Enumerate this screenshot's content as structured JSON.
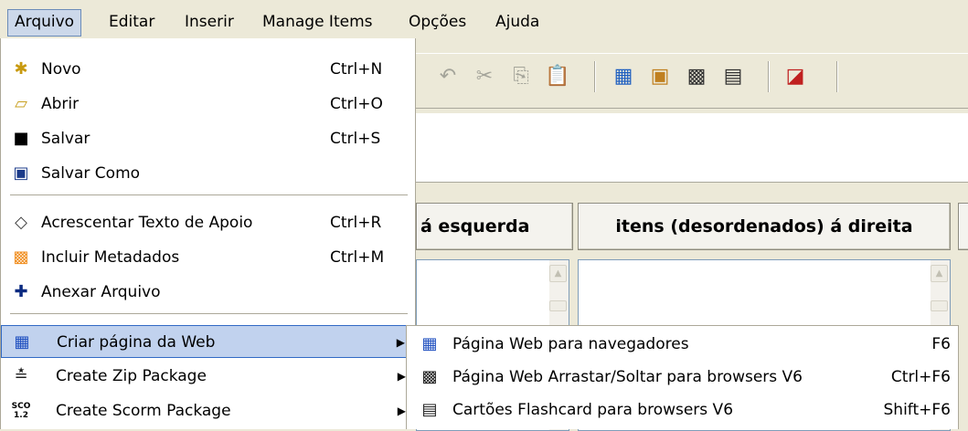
{
  "menubar": {
    "items": [
      "Arquivo",
      "Editar",
      "Inserir",
      "Manage Items",
      "Opções",
      "Ajuda"
    ]
  },
  "file_menu": {
    "items": [
      {
        "label": "Novo",
        "shortcut": "Ctrl+N",
        "icon": "new-file-icon"
      },
      {
        "label": "Abrir",
        "shortcut": "Ctrl+O",
        "icon": "open-folder-icon"
      },
      {
        "label": "Salvar",
        "shortcut": "Ctrl+S",
        "icon": "save-disk-icon"
      },
      {
        "label": "Salvar Como",
        "shortcut": "",
        "icon": "save-as-icon"
      },
      {
        "label": "Acrescentar Texto de Apoio",
        "shortcut": "Ctrl+R",
        "icon": "eraser-icon"
      },
      {
        "label": "Incluir Metadados",
        "shortcut": "Ctrl+M",
        "icon": "metadata-icon"
      },
      {
        "label": "Anexar Arquivo",
        "shortcut": "",
        "icon": "plus-icon"
      },
      {
        "label": "Criar página da Web",
        "shortcut": "",
        "icon": "web-page-icon",
        "highlighted": true
      },
      {
        "label": "Create Zip Package",
        "shortcut": "",
        "icon": "zip-icon"
      },
      {
        "label": "Create Scorm Package",
        "shortcut": "",
        "icon": "scorm-icon"
      }
    ],
    "scorm_icon_text": "SCO 1.2"
  },
  "submenu": {
    "items": [
      {
        "label": "Página Web para navegadores",
        "shortcut": "F6",
        "icon": "web-browser-icon"
      },
      {
        "label": "Página Web Arrastar/Soltar para browsers V6",
        "shortcut": "Ctrl+F6",
        "icon": "drag-drop-icon"
      },
      {
        "label": "Cartões Flashcard para browsers V6",
        "shortcut": "Shift+F6",
        "icon": "flashcard-icon"
      }
    ]
  },
  "headers": {
    "left": "á esquerda",
    "right": "itens (desordenados) á direita"
  },
  "colors": {
    "menu_highlight": "#c1d2ee",
    "menu_highlight_border": "#316ac5",
    "window_bg": "#ece9d8"
  }
}
